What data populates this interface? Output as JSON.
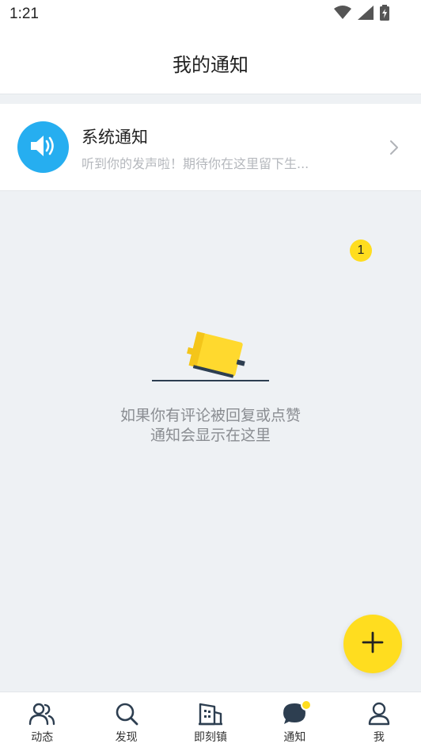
{
  "status_bar": {
    "time": "1:21"
  },
  "header": {
    "title": "我的通知"
  },
  "notice": {
    "name": "系统通知",
    "preview": "听到你的发声啦！期待你在这里留下生...",
    "badge_count": "1"
  },
  "empty_state": {
    "line1": "如果你有评论被回复或点赞",
    "line2": "通知会显示在这里"
  },
  "fab": {
    "icon": "plus-icon"
  },
  "tabs": [
    {
      "label": "动态",
      "icon": "people-icon"
    },
    {
      "label": "发现",
      "icon": "search-icon"
    },
    {
      "label": "即刻镇",
      "icon": "building-icon"
    },
    {
      "label": "通知",
      "icon": "chat-bubble-icon",
      "active": true
    },
    {
      "label": "我",
      "icon": "person-icon"
    }
  ],
  "colors": {
    "accent": "#ffdd1f",
    "avatar_blue": "#26aef0",
    "background": "#eef1f4"
  }
}
